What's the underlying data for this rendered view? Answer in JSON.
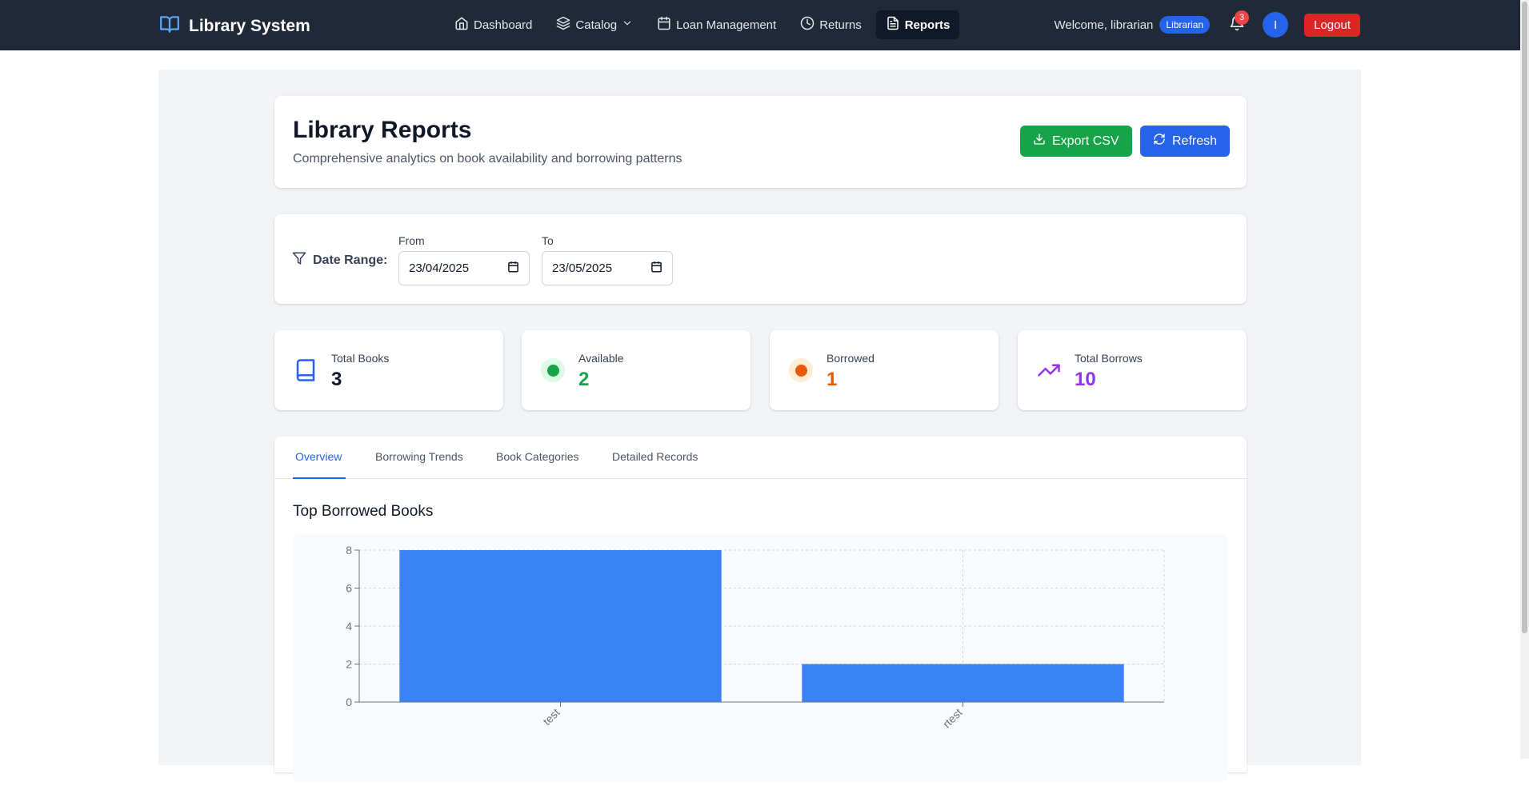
{
  "nav": {
    "brand": "Library System",
    "links": [
      {
        "label": "Dashboard",
        "icon": "home-icon"
      },
      {
        "label": "Catalog",
        "icon": "layers-icon",
        "dropdown": true
      },
      {
        "label": "Loan Management",
        "icon": "calendar-icon"
      },
      {
        "label": "Returns",
        "icon": "clock-icon"
      },
      {
        "label": "Reports",
        "icon": "file-text-icon",
        "active": true
      }
    ],
    "welcome": "Welcome, librarian",
    "role": "Librarian",
    "notification_count": "3",
    "avatar_initial": "I",
    "logout": "Logout"
  },
  "header": {
    "title": "Library Reports",
    "subtitle": "Comprehensive analytics on book availability and borrowing patterns",
    "export_label": "Export CSV",
    "refresh_label": "Refresh"
  },
  "filter": {
    "label": "Date Range:",
    "from_label": "From",
    "from_value": "23/04/2025",
    "to_label": "To",
    "to_value": "23/05/2025"
  },
  "stats": [
    {
      "label": "Total Books",
      "value": "3",
      "color": "#111827",
      "icon": "book-icon"
    },
    {
      "label": "Available",
      "value": "2",
      "color": "#16a34a",
      "icon": "available-dot-icon"
    },
    {
      "label": "Borrowed",
      "value": "1",
      "color": "#ea580c",
      "icon": "borrowed-dot-icon"
    },
    {
      "label": "Total Borrows",
      "value": "10",
      "color": "#9333ea",
      "icon": "trending-up-icon"
    }
  ],
  "tabs": [
    {
      "label": "Overview",
      "active": true
    },
    {
      "label": "Borrowing Trends"
    },
    {
      "label": "Book Categories"
    },
    {
      "label": "Detailed Records"
    }
  ],
  "section_title": "Top Borrowed Books",
  "colors": {
    "navbar": "#1f2937",
    "accent": "#2563eb",
    "export": "#16a34a",
    "logout": "#dc2626",
    "bar": "#3b82f6"
  },
  "chart_data": {
    "type": "bar",
    "title": "Top Borrowed Books",
    "categories": [
      "test",
      "rtest"
    ],
    "values": [
      8,
      2
    ],
    "xlabel": "",
    "ylabel": "",
    "ylim": [
      0,
      8
    ],
    "yticks": [
      0,
      2,
      4,
      6,
      8
    ],
    "grid": true,
    "color": "#3b82f6"
  }
}
